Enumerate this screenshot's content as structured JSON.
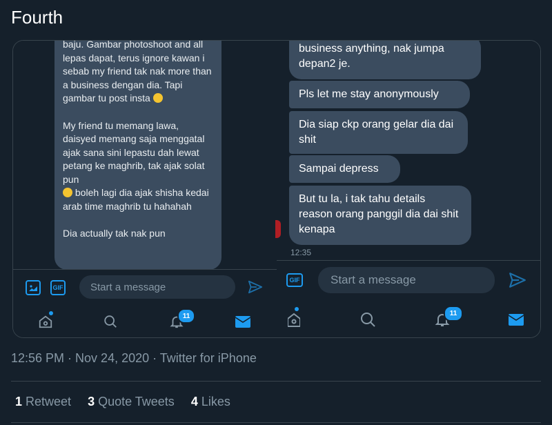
{
  "tweet": {
    "text": "Fourth",
    "timestamp": "12:56 PM · Nov 24, 2020 · Twitter for iPhone",
    "stats": [
      {
        "count": "1",
        "label": "Retweet"
      },
      {
        "count": "3",
        "label": "Quote Tweets"
      },
      {
        "count": "4",
        "label": "Likes"
      }
    ]
  },
  "left_screenshot": {
    "message_paragraphs": [
      "baju. Gambar photoshoot and all lepas dapat, terus ignore kawan i sebab my friend tak nak more than a business dengan dia. Tapi gambar tu post insta",
      "My friend tu memang lawa, daisyed memang saja menggatal ajak sana sini lepastu dah lewat petang ke maghrib, tak ajak solat pun",
      " boleh lagi dia ajak shisha kedai arab time maghrib tu hahahah",
      "Dia actually tak nak pun"
    ],
    "composer_placeholder": "Start a message",
    "gif_label": "GIF",
    "notification_count": "11"
  },
  "right_screenshot": {
    "messages": [
      "business anything, nak jumpa depan2 je.",
      "Pls let me stay anonymously",
      "Dia siap ckp orang gelar dia dai shit",
      "Sampai depress",
      "But tu la, i tak tahu details reason orang panggil dia dai shit kenapa"
    ],
    "time": "12:35",
    "composer_placeholder": "Start a message",
    "gif_label": "GIF",
    "notification_count": "11"
  },
  "colors": {
    "background": "#15202b",
    "bubble": "#3b4c5f",
    "accent": "#1d9bf0",
    "muted": "#8899a6"
  }
}
